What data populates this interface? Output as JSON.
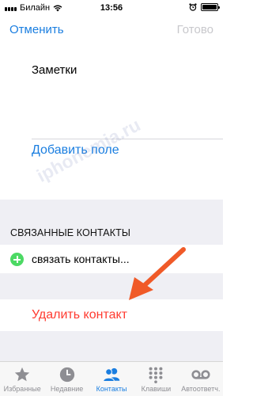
{
  "status": {
    "carrier": "Билайн",
    "time": "13:56"
  },
  "nav": {
    "cancel": "Отменить",
    "done": "Готово"
  },
  "form": {
    "notes_label": "Заметки",
    "add_field": "Добавить поле"
  },
  "related": {
    "header": "СВЯЗАННЫЕ КОНТАКТЫ",
    "link_label": "связать контакты..."
  },
  "delete": {
    "label": "Удалить контакт"
  },
  "watermark": "iphonemia.ru",
  "tabs": [
    {
      "label": "Избранные",
      "icon": "star-icon"
    },
    {
      "label": "Недавние",
      "icon": "clock-icon"
    },
    {
      "label": "Контакты",
      "icon": "contacts-icon"
    },
    {
      "label": "Клавиши",
      "icon": "keypad-icon"
    },
    {
      "label": "Автоответч.",
      "icon": "voicemail-icon"
    }
  ],
  "colors": {
    "accent": "#1a7ee0",
    "destructive": "#ff3b30",
    "add_green": "#4cd964",
    "arrow": "#f05a28",
    "group_background": "#efeff4"
  }
}
